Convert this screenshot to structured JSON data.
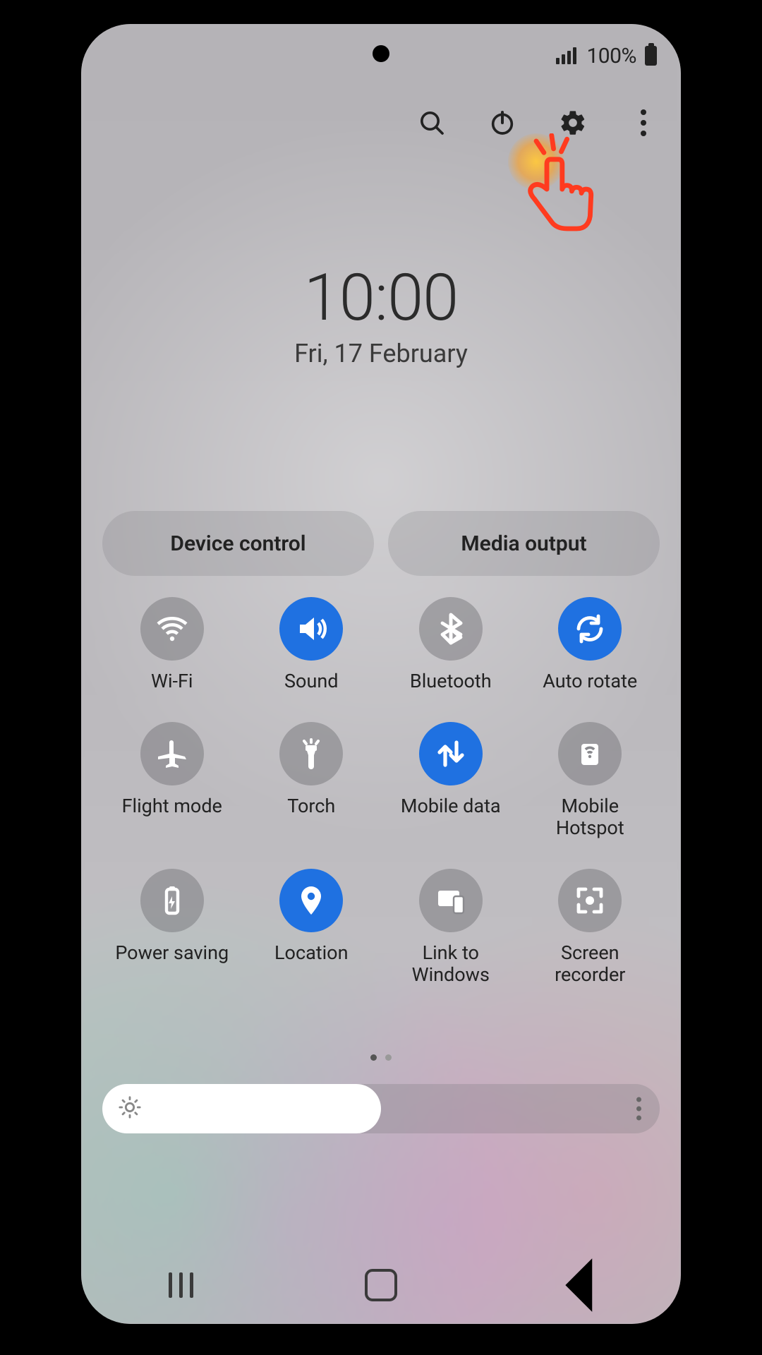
{
  "status": {
    "battery_pct": "100%"
  },
  "header_icons": {
    "search": "search-icon",
    "power": "power-icon",
    "settings": "gear-icon",
    "more": "more-vert-icon"
  },
  "clock": {
    "time": "10:00",
    "date": "Fri, 17 February"
  },
  "pills": [
    {
      "label": "Device control"
    },
    {
      "label": "Media output"
    }
  ],
  "qs_tiles": [
    {
      "id": "wifi",
      "label": "Wi-Fi",
      "on": false,
      "icon": "wifi-icon"
    },
    {
      "id": "sound",
      "label": "Sound",
      "on": true,
      "icon": "volume-icon"
    },
    {
      "id": "bluetooth",
      "label": "Bluetooth",
      "on": false,
      "icon": "bluetooth-icon"
    },
    {
      "id": "autorotate",
      "label": "Auto rotate",
      "on": true,
      "icon": "rotate-icon"
    },
    {
      "id": "flightmode",
      "label": "Flight mode",
      "on": false,
      "icon": "airplane-icon"
    },
    {
      "id": "torch",
      "label": "Torch",
      "on": false,
      "icon": "flashlight-icon"
    },
    {
      "id": "mobiledata",
      "label": "Mobile data",
      "on": true,
      "icon": "data-arrows-icon"
    },
    {
      "id": "mobilehotspot",
      "label": "Mobile Hotspot",
      "on": false,
      "icon": "hotspot-icon"
    },
    {
      "id": "powersaving",
      "label": "Power saving",
      "on": false,
      "icon": "battery-saver-icon"
    },
    {
      "id": "location",
      "label": "Location",
      "on": true,
      "icon": "location-pin-icon"
    },
    {
      "id": "linktowindows",
      "label": "Link to Windows",
      "on": false,
      "icon": "link-windows-icon"
    },
    {
      "id": "screenrecorder",
      "label": "Screen recorder",
      "on": false,
      "icon": "screen-record-icon"
    }
  ],
  "pager": {
    "current": 0,
    "count": 2
  },
  "brightness": {
    "percent": 50
  },
  "colors": {
    "accent_on": "#1f71e1",
    "tile_off": "rgba(110,110,115,0.45)",
    "tap_highlight": "#ff5a2a"
  },
  "annotation": {
    "tap_target": "settings-button"
  }
}
